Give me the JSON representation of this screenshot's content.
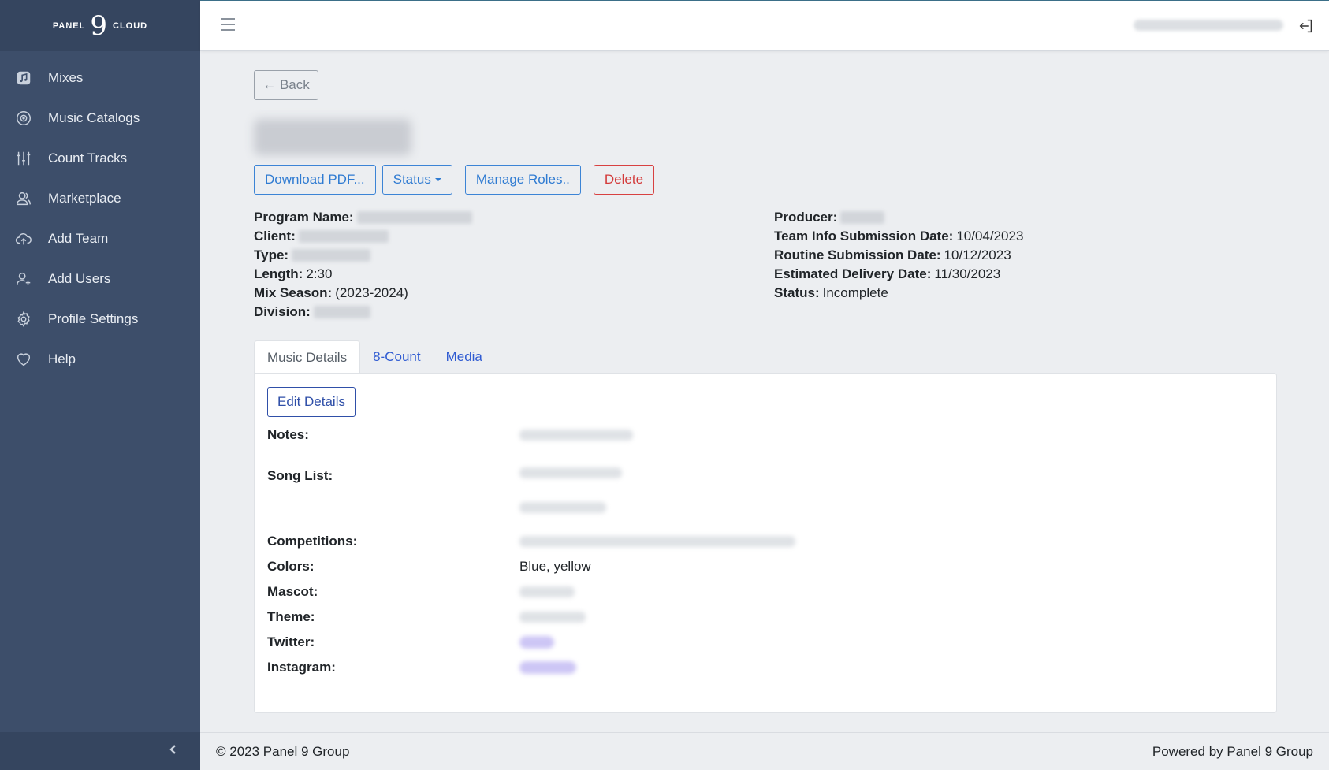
{
  "brand": {
    "left": "PANEL",
    "nine": "9",
    "right": "CLOUD"
  },
  "sidebar": {
    "items": [
      {
        "label": "Mixes",
        "icon": "music-note-icon"
      },
      {
        "label": "Music Catalogs",
        "icon": "disc-icon"
      },
      {
        "label": "Count Tracks",
        "icon": "sliders-icon"
      },
      {
        "label": "Marketplace",
        "icon": "people-icon"
      },
      {
        "label": "Add Team",
        "icon": "cloud-upload-icon"
      },
      {
        "label": "Add Users",
        "icon": "user-plus-icon"
      },
      {
        "label": "Profile Settings",
        "icon": "gear-icon"
      },
      {
        "label": "Help",
        "icon": "heart-icon"
      }
    ]
  },
  "toolbar": {
    "back_label": "← Back"
  },
  "actions": {
    "download": "Download PDF...",
    "status": "Status",
    "manage_roles": "Manage Roles..",
    "delete": "Delete"
  },
  "info": {
    "program_name_label": "Program Name:",
    "client_label": "Client:",
    "type_label": "Type:",
    "length_label": "Length:",
    "length_value": "2:30",
    "mix_season_label": "Mix Season:",
    "mix_season_value": "(2023-2024)",
    "division_label": "Division:",
    "producer_label": "Producer:",
    "team_info_label": "Team Info Submission Date:",
    "team_info_value": "10/04/2023",
    "routine_label": "Routine Submission Date:",
    "routine_value": "10/12/2023",
    "delivery_label": "Estimated Delivery Date:",
    "delivery_value": "11/30/2023",
    "status_label": "Status:",
    "status_value": "Incomplete"
  },
  "tabs": [
    "Music Details",
    "8-Count",
    "Media"
  ],
  "details": {
    "edit_label": "Edit Details",
    "notes_label": "Notes:",
    "song_list_label": "Song List:",
    "competitions_label": "Competitions:",
    "colors_label": "Colors:",
    "colors_value": "Blue, yellow",
    "mascot_label": "Mascot:",
    "theme_label": "Theme:",
    "twitter_label": "Twitter:",
    "instagram_label": "Instagram:"
  },
  "footer": {
    "copyright": "© 2023 Panel 9 Group",
    "powered": "Powered by Panel 9 Group"
  },
  "colors": {
    "sidebar_bg": "#3d4e6a",
    "primary": "#2f7bd2",
    "danger": "#d33a3a",
    "link": "#2f5bd2"
  }
}
